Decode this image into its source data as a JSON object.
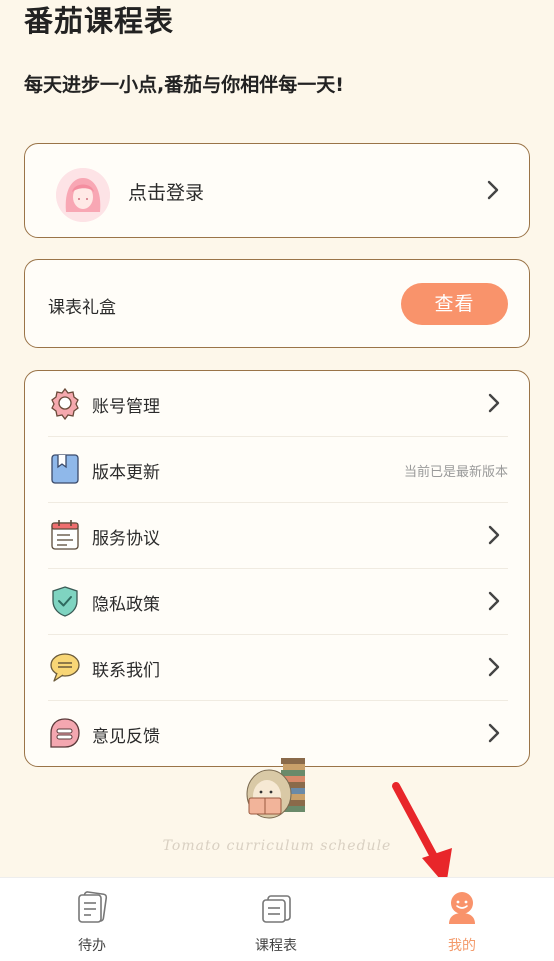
{
  "app": {
    "title": "番茄课程表",
    "subtitle": "每天进步一小点,番茄与你相伴每一天!"
  },
  "login": {
    "label": "点击登录"
  },
  "gift": {
    "label": "课表礼盒",
    "button": "查看"
  },
  "menu": [
    {
      "label": "账号管理",
      "icon": "gear-icon"
    },
    {
      "label": "版本更新",
      "icon": "bookmark-icon",
      "status": "当前已是最新版本"
    },
    {
      "label": "服务协议",
      "icon": "calendar-doc-icon"
    },
    {
      "label": "隐私政策",
      "icon": "shield-check-icon"
    },
    {
      "label": "联系我们",
      "icon": "chat-bubble-icon"
    },
    {
      "label": "意见反馈",
      "icon": "feedback-icon"
    }
  ],
  "footer": {
    "text": "Tomato curriculum schedule"
  },
  "tabs": [
    {
      "label": "待办",
      "icon": "todo-icon"
    },
    {
      "label": "课程表",
      "icon": "schedule-icon"
    },
    {
      "label": "我的",
      "icon": "profile-icon",
      "active": true
    }
  ],
  "colors": {
    "accent": "#f9936b",
    "border": "#9a7448",
    "background": "#fdf7ea",
    "active_tab": "#f39a6b"
  }
}
